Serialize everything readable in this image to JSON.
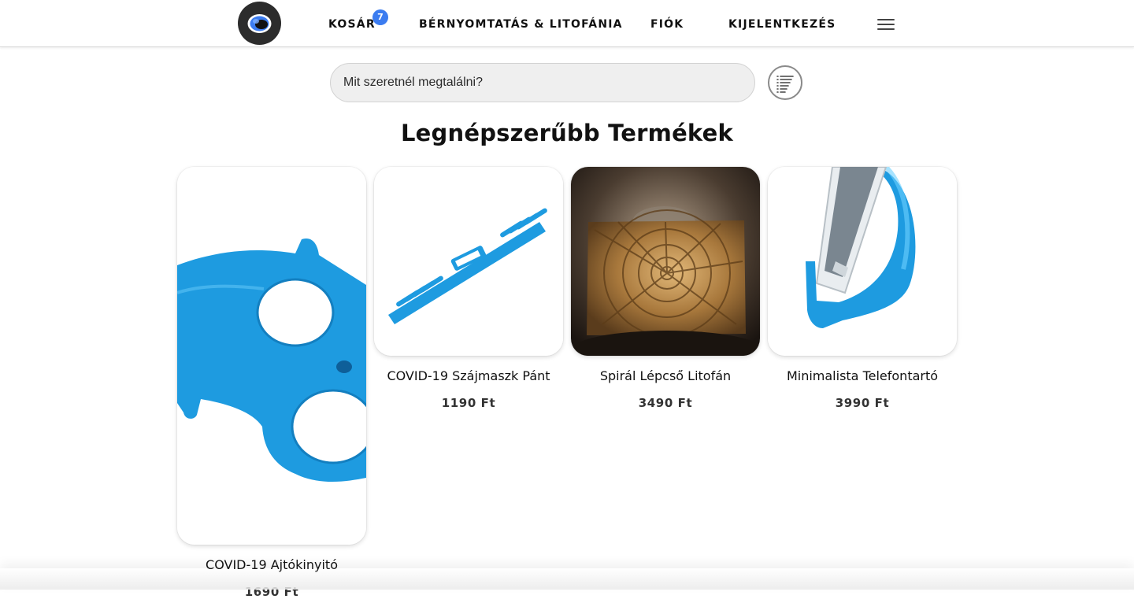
{
  "nav": {
    "cart_label": "KOSÁR",
    "cart_count": "7",
    "print_label": "BÉRNYOMTATÁS & LITOFÁNIA",
    "account_label": "FIÓK",
    "logout_label": "KIJELENTKEZÉS",
    "menu_icon": "hamburger-menu-icon",
    "badge_color": "#3b7cf0"
  },
  "search": {
    "placeholder": "Mit szeretnél megtalálni?",
    "value": "",
    "filter_icon": "list-filter-icon"
  },
  "section": {
    "title": "Legnépszerűbb Termékek"
  },
  "products": [
    {
      "name": "COVID-19 Ajtókinyitó",
      "price": "1690 Ft"
    },
    {
      "name": "COVID-19 Szájmaszk Pánt",
      "price": "1190 Ft"
    },
    {
      "name": "Spirál Lépcső Litofán",
      "price": "3490 Ft"
    },
    {
      "name": "Minimalista Telefontartó",
      "price": "3990 Ft"
    }
  ],
  "colors": {
    "accent": "#3b7cf0",
    "product_blue": "#1e9be0"
  }
}
